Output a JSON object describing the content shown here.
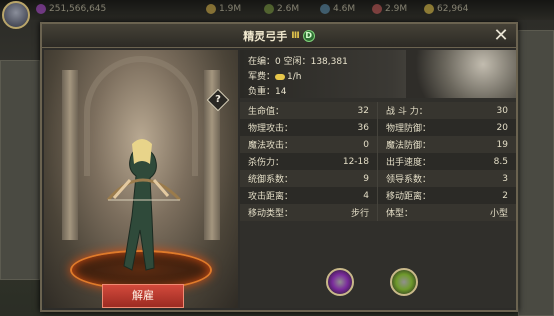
{
  "topbar": {
    "gems": "251,566,645",
    "resources": [
      "1.9M",
      "2.6M",
      "4.6M",
      "2.9M",
      "62,964"
    ]
  },
  "dialog": {
    "title": "精灵弓手",
    "rank": "Ⅲ",
    "tier": "D",
    "close_icon": "close-icon"
  },
  "portrait": {
    "dismiss_label": "解雇",
    "help_label": "?"
  },
  "summary": {
    "status_line": "在编：0  空闲：138,381",
    "upkeep_label": "军费：",
    "upkeep_value": "1/h",
    "load_line": "负重：14"
  },
  "stats": [
    {
      "l_label": "生命值：",
      "l_value": "32",
      "r_label": "战 斗 力：",
      "r_value": "30"
    },
    {
      "l_label": "物理攻击：",
      "l_value": "36",
      "r_label": "物理防御：",
      "r_value": "20"
    },
    {
      "l_label": "魔法攻击：",
      "l_value": "0",
      "r_label": "魔法防御：",
      "r_value": "19"
    },
    {
      "l_label": "杀伤力：",
      "l_value": "12-18",
      "r_label": "出手速度：",
      "r_value": "8.5"
    },
    {
      "l_label": "统御系数：",
      "l_value": "9",
      "r_label": "领导系数：",
      "r_value": "3"
    },
    {
      "l_label": "攻击距离：",
      "l_value": "4",
      "r_label": "移动距离：",
      "r_value": "2"
    },
    {
      "l_label": "移动类型：",
      "l_value": "步行",
      "r_label": "体型：",
      "r_value": "小型"
    }
  ],
  "skills": [
    {
      "name": "purple-skill-icon",
      "color": "#7a2a9c"
    },
    {
      "name": "green-skill-icon",
      "color": "#6f9a2c"
    }
  ],
  "colors": {
    "accent": "#e2c44c",
    "dismiss": "#c03a2e",
    "frame": "#6b6350"
  }
}
